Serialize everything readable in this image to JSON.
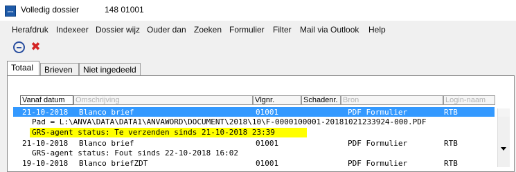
{
  "window": {
    "title": "Volledig dossier",
    "number": "148 01001",
    "app_icon_text": "anva"
  },
  "menu": [
    {
      "label": "Herafdruk"
    },
    {
      "label": "Indexeer"
    },
    {
      "label": "Dossier wijz"
    },
    {
      "label": "Ouder dan"
    },
    {
      "label": "Zoeken"
    },
    {
      "label": "Formulier"
    },
    {
      "label": "Filter"
    },
    {
      "label": "Mail via Outlook"
    },
    {
      "label": "Help"
    }
  ],
  "toolbar": {
    "remove_icon": "minus-circle-icon",
    "close_icon": "red-x-icon"
  },
  "tabs": [
    {
      "label": "Totaal",
      "active": true
    },
    {
      "label": "Brieven",
      "active": false
    },
    {
      "label": "Niet ingedeeld",
      "active": false
    }
  ],
  "columns": [
    {
      "label": "Vanaf datum",
      "active": true
    },
    {
      "label": "Omschrijving",
      "dim": true
    },
    {
      "label": "Vlgnr."
    },
    {
      "label": "Schadenr."
    },
    {
      "label": "Bron",
      "dim": true
    },
    {
      "label": "Login-naam",
      "dim": true
    }
  ],
  "rows": [
    {
      "date": "21-10-2018",
      "desc": "Blanco brief",
      "vlgnr": "01001",
      "bron": "PDF Formulier",
      "login": "RTB"
    },
    {
      "path": "Pad = L:\\ANVA\\DATA\\DATA1\\ANVAWORD\\DOCUMENT\\2018\\10\\F-0000100001-20181021233924-000.PDF"
    },
    {
      "status": "GRS-agent status: Te verzenden sinds 21-10-2018 23:39"
    },
    {
      "date": "21-10-2018",
      "desc": "Blanco brief",
      "vlgnr": "01001",
      "bron": "PDF Formulier",
      "login": "RTB"
    },
    {
      "status": "GRS-agent status: Fout sinds 22-10-2018 16:02"
    },
    {
      "date": "19-10-2018",
      "desc": "Blanco briefZDT",
      "vlgnr": "01001",
      "bron": "PDF Formulier",
      "login": "RTB"
    }
  ],
  "colors": {
    "selection": "#3399ff",
    "highlight": "#ffff00"
  }
}
